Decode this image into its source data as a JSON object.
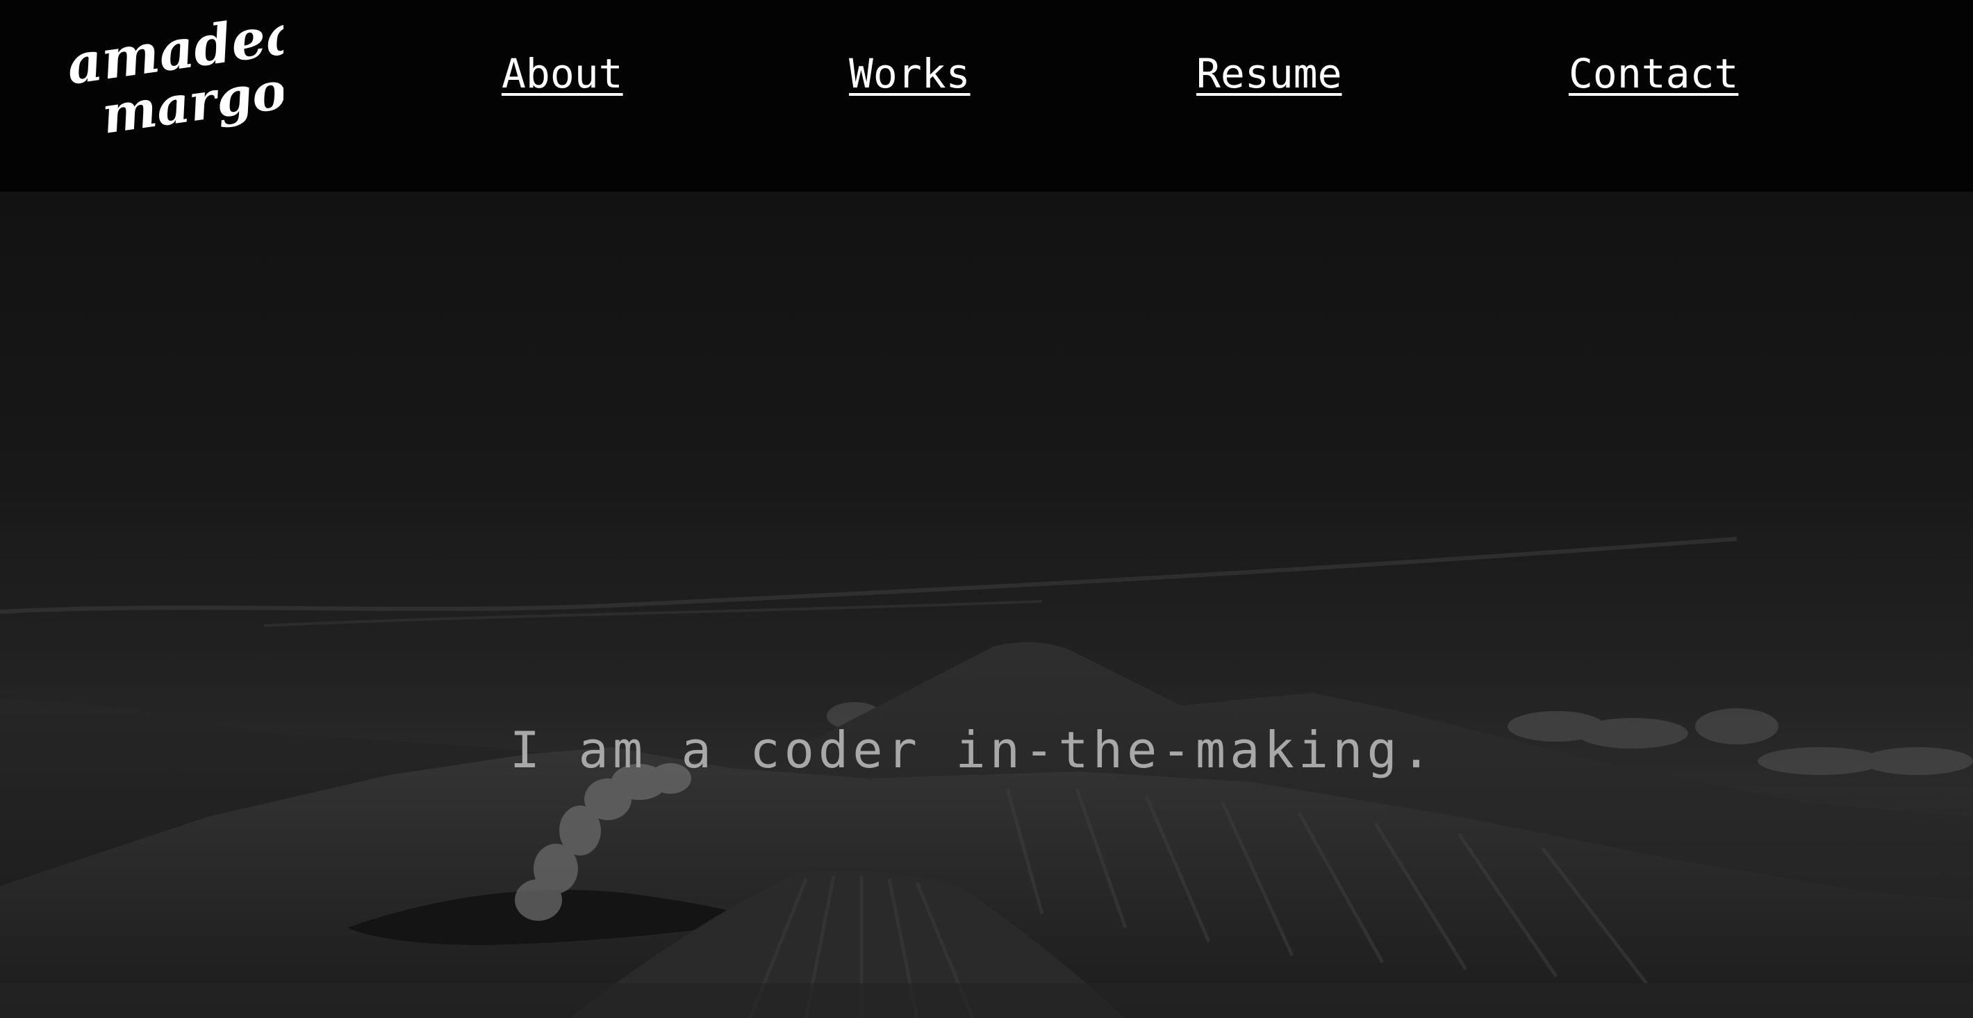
{
  "logo": {
    "line1": "amadea",
    "line2": "margo"
  },
  "nav": {
    "items": [
      "About",
      "Works",
      "Resume",
      "Contact"
    ]
  },
  "hero": {
    "tagline": "I am a coder in-the-making."
  },
  "colors": {
    "header_bg": "#030303",
    "nav_text": "#ffffff",
    "tagline_text": "#a8a8a8"
  }
}
